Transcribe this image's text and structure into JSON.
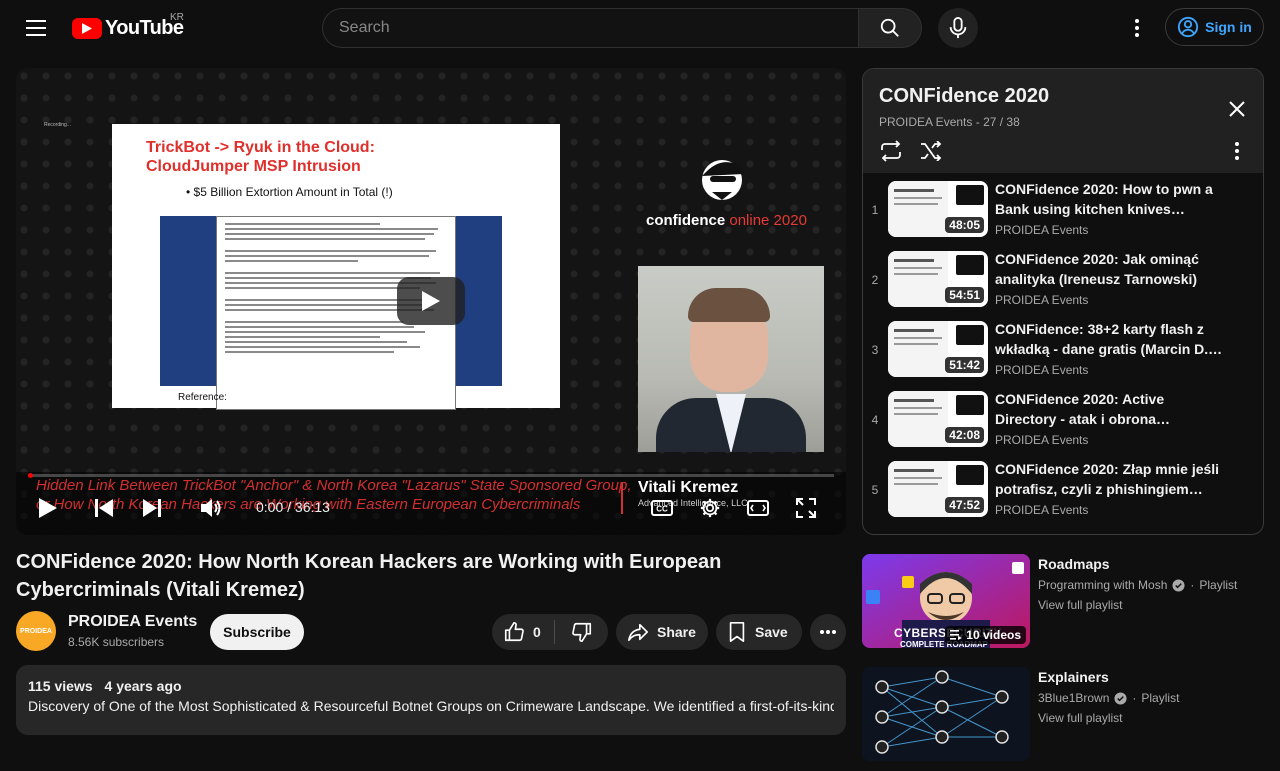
{
  "header": {
    "logo_text": "YouTube",
    "country": "KR",
    "search_placeholder": "Search",
    "sign_in": "Sign in"
  },
  "player": {
    "recording_label": "Recording...",
    "slide": {
      "title_line1": "TrickBot -> Ryuk in the Cloud:",
      "title_line2": "CloudJumper MSP Intrusion",
      "bullet": "• $5 Billion Extortion Amount in Total (!)",
      "reference": "Reference:"
    },
    "event_brand": "confidence",
    "event_brand_accent": "online 2020",
    "banner_line1": "Hidden Link Between TrickBot \"Anchor\" & North Korea \"Lazarus\" State Sponsored Group,",
    "banner_line2": "or How North Korean Hackers are Working with Eastern European Cybercriminals",
    "speaker_name": "Vitali Kremez",
    "speaker_org": "Advanced Intelligence, LLC",
    "time_current": "0:00",
    "time_separator": "/",
    "time_total": "36:13",
    "progress_fraction": 0
  },
  "video": {
    "title": "CONFidence 2020: How North Korean Hackers are Working with European Cybercriminals (Vitali Kremez)",
    "channel": "PROIDEA Events",
    "avatar_text": "PROIDEA",
    "subscribers": "8.56K subscribers",
    "subscribe_label": "Subscribe",
    "likes": "0",
    "share_label": "Share",
    "save_label": "Save",
    "views": "115 views",
    "age": "4 years ago",
    "description": "Discovery of One of the Most Sophisticated & Resourceful Botnet Groups on Crimeware Landscape. We identified a first-of-its-kind"
  },
  "playlist": {
    "title": "CONFidence 2020",
    "owner": "PROIDEA Events",
    "position": "27 / 38",
    "items": [
      {
        "index": "1",
        "title": "CONFidence 2020: How to pwn a Bank using kitchen knives…",
        "channel": "PROIDEA Events",
        "duration": "48:05"
      },
      {
        "index": "2",
        "title": "CONFidence 2020: Jak ominąć analityka (Ireneusz Tarnowski)",
        "channel": "PROIDEA Events",
        "duration": "54:51"
      },
      {
        "index": "3",
        "title": "CONFidence: 38+2 karty flash z wkładką - dane gratis (Marcin D.…",
        "channel": "PROIDEA Events",
        "duration": "51:42"
      },
      {
        "index": "4",
        "title": "CONFidence 2020: Active Directory - atak i obrona…",
        "channel": "PROIDEA Events",
        "duration": "42:08"
      },
      {
        "index": "5",
        "title": "CONFidence 2020: Złap mnie jeśli potrafisz, czyli z phishingiem…",
        "channel": "PROIDEA Events",
        "duration": "47:52"
      }
    ]
  },
  "related": [
    {
      "title": "Roadmaps",
      "channel": "Programming with Mosh",
      "type": "Playlist",
      "link": "View full playlist",
      "count": "10 videos",
      "thumb_text": "CYBERSECURITY",
      "thumb_sub": "COMPLETE ROADMAP"
    },
    {
      "title": "Explainers",
      "channel": "3Blue1Brown",
      "type": "Playlist",
      "link": "View full playlist"
    }
  ],
  "colors": {
    "background": "#0f0f0f",
    "accent_red": "#ff0000",
    "link_blue": "#3ea6ff",
    "surface": "#272727"
  }
}
